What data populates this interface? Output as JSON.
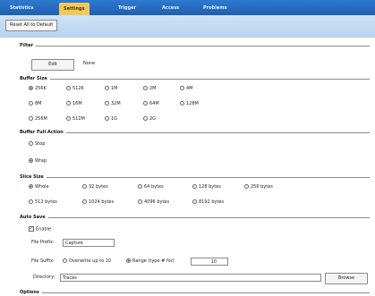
{
  "tabs": [
    "Statistics",
    "Settings",
    "Trigger",
    "Access",
    "Problems"
  ],
  "toolbar": {
    "reset_label": "Reset All to Default"
  },
  "filter": {
    "title": "Filter",
    "edit_label": "Edit",
    "value": "None"
  },
  "buffer_size": {
    "title": "Buffer Size",
    "options": [
      "256K",
      "512K",
      "1M",
      "2M",
      "4M",
      "8M",
      "16M",
      "32M",
      "64M",
      "128M",
      "256M",
      "512M",
      "1G",
      "2G"
    ],
    "selected": "256K"
  },
  "buffer_full_action": {
    "title": "Buffer Full Action",
    "options": [
      "Stop",
      "Wrap"
    ],
    "selected": "Wrap"
  },
  "slice_size": {
    "title": "Slice Size",
    "options": [
      "Whole",
      "32 bytes",
      "64 bytes",
      "128 bytes",
      "256 bytes",
      "512 bytes",
      "1024 bytes",
      "4096 bytes",
      "8192 bytes"
    ],
    "selected": "Whole"
  },
  "auto_save": {
    "title": "Auto Save",
    "enable_label": "Enable",
    "file_prefix_label": "File Prefix:",
    "file_prefix_value": "Capture",
    "file_suffix_label": "File Suffix:",
    "suffix_option_1": "Overwrite up to 10",
    "suffix_option_2": "Range (type # for)",
    "suffix_value": "10",
    "directory_label": "Directory:",
    "directory_value": "Traces",
    "browse_label": "Browse"
  },
  "next_section": {
    "title": "Options"
  },
  "colors": {
    "tab_bar": "#1f5fae",
    "active_tab": "#f3c85a",
    "strip": "#c4daf3"
  }
}
